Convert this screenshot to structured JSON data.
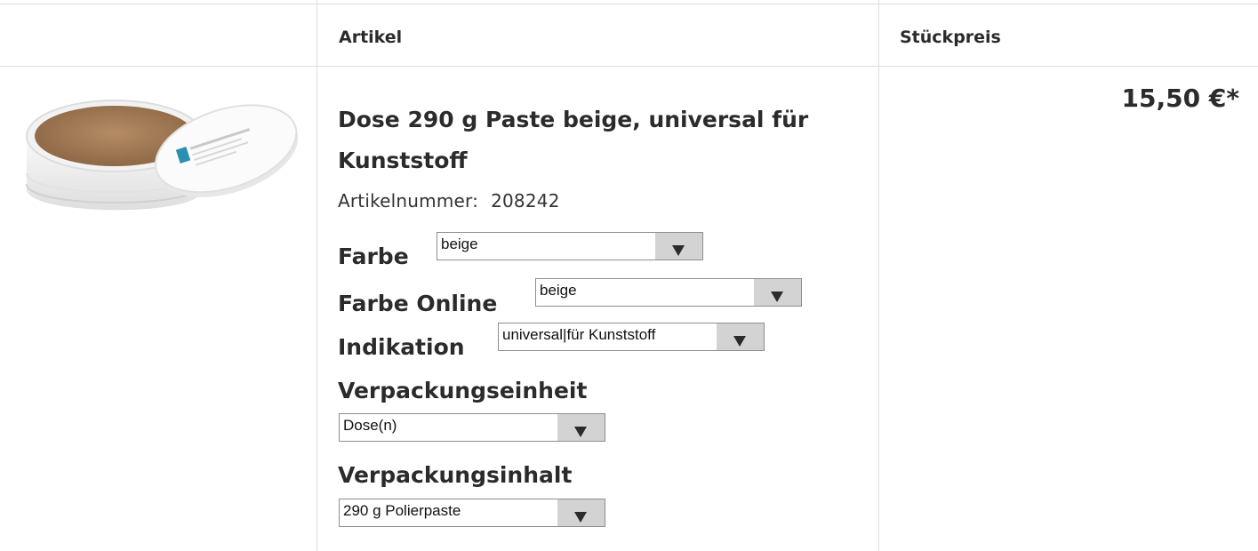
{
  "table": {
    "headers": {
      "col1": "",
      "artikel": "Artikel",
      "preis": "Stückpreis"
    }
  },
  "product": {
    "image_icon": "paste-tin-image",
    "title": "Dose 290 g Paste beige, universal für Kunststoff",
    "artikelnummer_label": "Artikelnummer:",
    "artikelnummer_value": "208242",
    "price": "15,50 €*",
    "options": [
      {
        "label": "Farbe",
        "value": "beige"
      },
      {
        "label": "Farbe Online",
        "value": "beige"
      },
      {
        "label": "Indikation",
        "value": "universal|für Kunststoff"
      },
      {
        "label": "Verpackungseinheit",
        "value": "Dose(n)"
      },
      {
        "label": "Verpackungsinhalt",
        "value": "290 g Polierpaste"
      }
    ]
  },
  "colors": {
    "border": "#dcdcdc",
    "text": "#2b2b2b",
    "select_button": "#d3d3d3"
  }
}
